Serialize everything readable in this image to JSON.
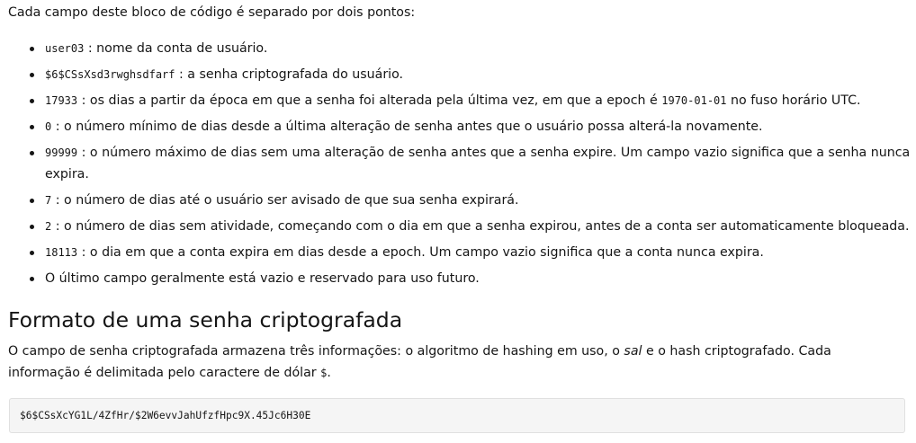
{
  "intro": "Cada campo deste bloco de código é separado por dois pontos:",
  "fields": [
    {
      "code": "user03",
      "text": " : nome da conta de usuário."
    },
    {
      "code": "$6$CSsXsd3rwghsdfarf",
      "text": " : a senha criptografada do usuário."
    },
    {
      "code": "17933",
      "text": " : os dias a partir da época em que a senha foi alterada pela última vez, em que a epoch é ",
      "code2": "1970-01-01",
      "text2": " no fuso horário UTC."
    },
    {
      "code": "0",
      "text": " : o número mínimo de dias desde a última alteração de senha antes que o usuário possa alterá-la novamente."
    },
    {
      "code": "99999",
      "text": " : o número máximo de dias sem uma alteração de senha antes que a senha expire. Um campo vazio significa que a senha nunca expira."
    },
    {
      "code": "7",
      "text": " : o número de dias até o usuário ser avisado de que sua senha expirará."
    },
    {
      "code": "2",
      "text": " : o número de dias sem atividade, começando com o dia em que a senha expirou, antes de a conta ser automaticamente bloqueada."
    },
    {
      "code": "18113",
      "text": " : o dia em que a conta expira em dias desde a epoch. Um campo vazio significa que a conta nunca expira."
    },
    {
      "code": "",
      "text": "O último campo geralmente está vazio e reservado para uso futuro."
    }
  ],
  "section": {
    "heading": "Formato de uma senha criptografada",
    "para_a": "O campo de senha criptografada armazena três informações: o algoritmo de hashing em uso, o ",
    "para_em": "sal",
    "para_b": " e o hash criptografado. Cada informação é delimitada pelo caractere de dólar ",
    "para_code": "$",
    "para_c": "."
  },
  "codeblock": "$6$CSsXcYG1L/4ZfHr/$2W6evvJahUfzfHpc9X.45Jc6H30E"
}
